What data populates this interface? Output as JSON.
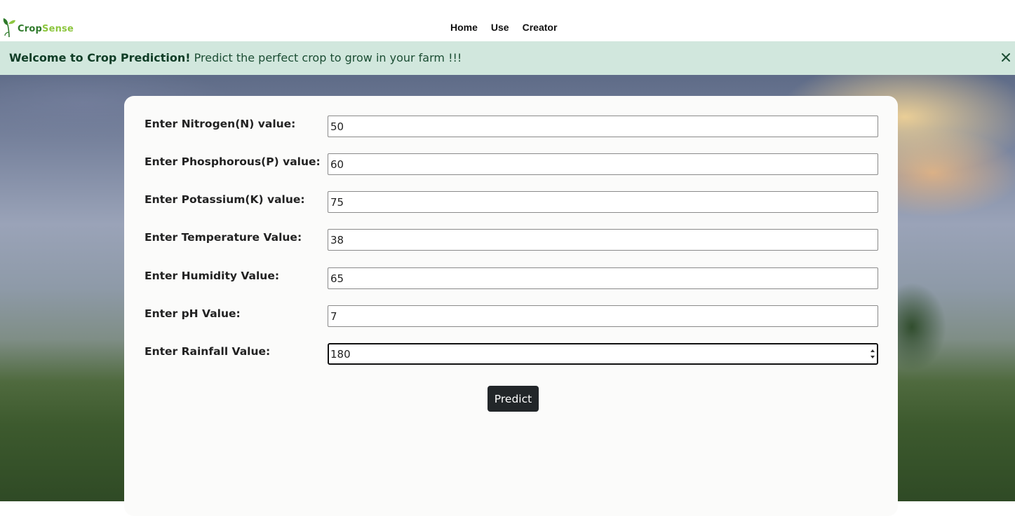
{
  "brand": {
    "name_part1": "Crop",
    "name_part2": "Sense"
  },
  "nav": {
    "links": [
      {
        "label": "Home"
      },
      {
        "label": "Use"
      },
      {
        "label": "Creator"
      }
    ]
  },
  "alert": {
    "title": "Welcome to Crop Prediction!",
    "message": "Predict the perfect crop to grow in your farm !!!",
    "close_icon": "close-icon"
  },
  "form": {
    "fields": [
      {
        "label": "Enter Nitrogen(N) value:",
        "value": "50"
      },
      {
        "label": "Enter Phosphorous(P) value:",
        "value": "60"
      },
      {
        "label": "Enter Potassium(K) value:",
        "value": "75"
      },
      {
        "label": "Enter Temperature Value:",
        "value": "38"
      },
      {
        "label": "Enter Humidity Value:",
        "value": "65"
      },
      {
        "label": "Enter pH Value:",
        "value": "7"
      },
      {
        "label": "Enter Rainfall Value:",
        "value": "180"
      }
    ],
    "submit_label": "Predict"
  },
  "colors": {
    "alert_bg": "#d1e7dd",
    "button_bg": "#222629",
    "brand_dark": "#2f7a2b",
    "brand_light": "#8dc63f"
  }
}
